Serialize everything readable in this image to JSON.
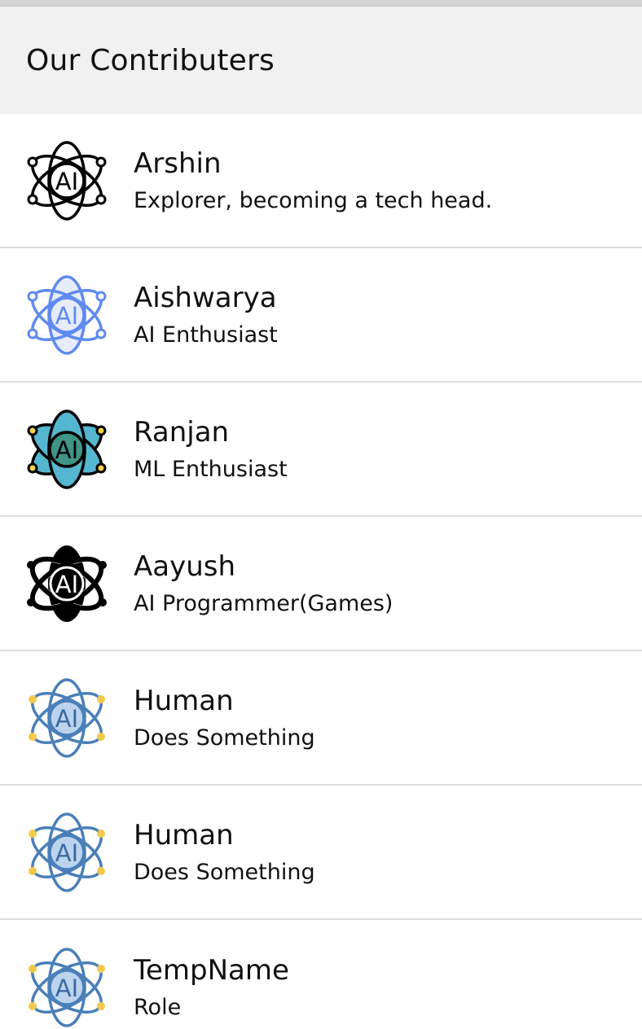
{
  "header": {
    "title": "Our Contributers"
  },
  "contributors": [
    {
      "name": "Arshin",
      "role": "Explorer, becoming a tech head.",
      "icon": "ai-atom-outline-icon"
    },
    {
      "name": "Aishwarya",
      "role": "AI Enthusiast",
      "icon": "ai-atom-blue-outline-icon"
    },
    {
      "name": "Ranjan",
      "role": "ML Enthusiast",
      "icon": "ai-atom-teal-icon"
    },
    {
      "name": "Aayush",
      "role": "AI Programmer(Games)",
      "icon": "ai-atom-solid-black-icon"
    },
    {
      "name": "Human",
      "role": "Does Something",
      "icon": "ai-atom-lightblue-icon"
    },
    {
      "name": "Human",
      "role": "Does Something",
      "icon": "ai-atom-lightblue-icon"
    },
    {
      "name": "TempName",
      "role": "Role",
      "icon": "ai-atom-lightblue-icon"
    }
  ],
  "icon_text": "AI",
  "colors": {
    "header_bg": "#f1f1f1",
    "divider": "#dcdcdc",
    "text": "#111111"
  }
}
